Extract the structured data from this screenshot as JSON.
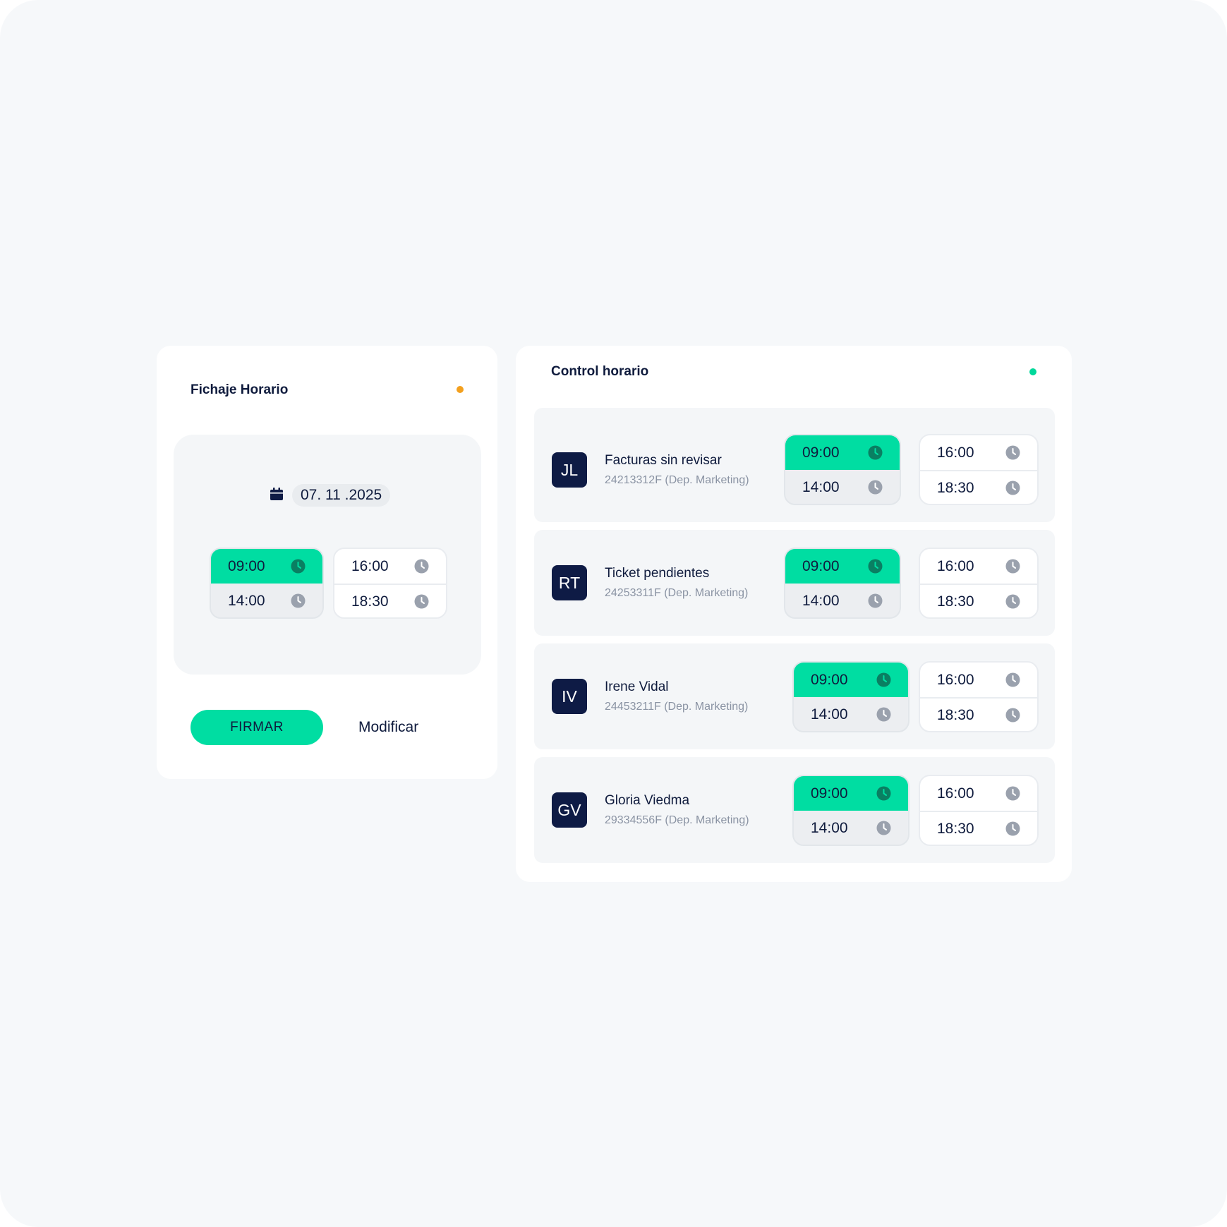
{
  "colors": {
    "accent": "#00dda2",
    "navy": "#0e1b45",
    "pending_dot": "#f3a01e",
    "online_dot": "#00d89b"
  },
  "fichaje": {
    "title": "Fichaje Horario",
    "date": "07. 11 .2025",
    "start_block": {
      "in": "09:00",
      "out": "14:00"
    },
    "end_block": {
      "in": "16:00",
      "out": "18:30"
    },
    "sign_label": "FIRMAR",
    "modify_label": "Modificar"
  },
  "control": {
    "title": "Control horario",
    "employees": [
      {
        "initials": "JL",
        "name": "Facturas sin revisar",
        "sub": "24213312F (Dep. Marketing)",
        "start_in": "09:00",
        "start_out": "14:00",
        "end_in": "16:00",
        "end_out": "18:30"
      },
      {
        "initials": "RT",
        "name": "Ticket pendientes",
        "sub": "24253311F (Dep. Marketing)",
        "start_in": "09:00",
        "start_out": "14:00",
        "end_in": "16:00",
        "end_out": "18:30"
      },
      {
        "initials": "IV",
        "name": "Irene Vidal",
        "sub": "24453211F (Dep. Marketing)",
        "start_in": "09:00",
        "start_out": "14:00",
        "end_in": "16:00",
        "end_out": "18:30"
      },
      {
        "initials": "GV",
        "name": "Gloria Viedma",
        "sub": "29334556F (Dep. Marketing)",
        "start_in": "09:00",
        "start_out": "14:00",
        "end_in": "16:00",
        "end_out": "18:30"
      }
    ]
  }
}
